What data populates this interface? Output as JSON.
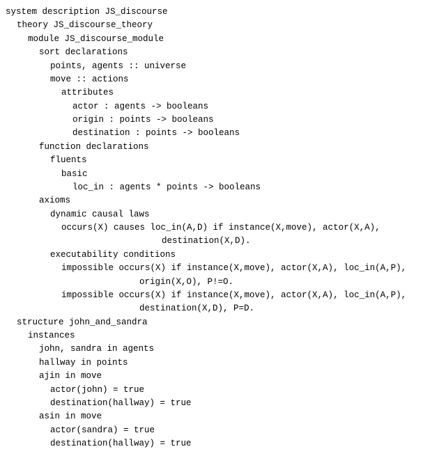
{
  "lines": {
    "l01": "system description JS_discourse",
    "l02": "theory JS_discourse_theory",
    "l03": "module JS_discourse_module",
    "l04": "sort declarations",
    "l05": "points, agents :: universe",
    "l06": "move :: actions",
    "l07": "attributes",
    "l08": "actor : agents -> booleans",
    "l09": "origin : points -> booleans",
    "l10": "destination : points -> booleans",
    "l11": "function declarations",
    "l12": "fluents",
    "l13": "basic",
    "l14": "loc_in : agents * points -> booleans",
    "l15": "axioms",
    "l16": "dynamic causal laws",
    "l17": "occurs(X) causes loc_in(A,D) if instance(X,move), actor(X,A),",
    "l18": "destination(X,D).",
    "l19": "executability conditions",
    "l20": "impossible occurs(X) if instance(X,move), actor(X,A), loc_in(A,P),",
    "l21": "origin(X,O), P!=O.",
    "l22": "impossible occurs(X) if instance(X,move), actor(X,A), loc_in(A,P),",
    "l23": "destination(X,D), P=D.",
    "l24": "structure john_and_sandra",
    "l25": "instances",
    "l26": "john, sandra in agents",
    "l27": "hallway in points",
    "l28": "ajin in move",
    "l29": "actor(john) = true",
    "l30": "destination(hallway) = true",
    "l31": "asin in move",
    "l32": "actor(sandra) = true",
    "l33": "destination(hallway) = true"
  }
}
